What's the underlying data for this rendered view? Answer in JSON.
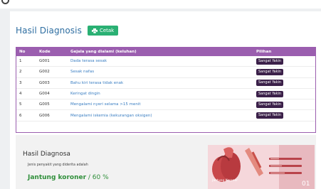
{
  "page": {
    "title": "Hasil Diagnosis",
    "print_button_label": "Cetak"
  },
  "table": {
    "headers": [
      "No",
      "Kode",
      "Gejala yang dialami (keluhan)",
      "Pilihan"
    ],
    "rows": [
      {
        "no": "1",
        "kode": "G001",
        "gejala": "Dada terasa sesak",
        "pilihan": "Sangat Yakin"
      },
      {
        "no": "2",
        "kode": "G002",
        "gejala": "Sesak nafas",
        "pilihan": "Sangat Yakin"
      },
      {
        "no": "3",
        "kode": "G003",
        "gejala": "Bahu kiri terasa tidak enak",
        "pilihan": "Sangat Yakin"
      },
      {
        "no": "4",
        "kode": "G004",
        "gejala": "Keringat dingin",
        "pilihan": "Sangat Yakin"
      },
      {
        "no": "5",
        "kode": "G005",
        "gejala": "Mengalami nyeri selama >15 menit",
        "pilihan": "Sangat Yakin"
      },
      {
        "no": "6",
        "kode": "G006",
        "gejala": "Mengalami iskemia (kekurangan oksigen)",
        "pilihan": "Sangat Yakin"
      }
    ]
  },
  "result": {
    "title": "Hasil Diagnosa",
    "description": "Jenis penyakit yang diderita adalah",
    "diagnosis": "Jantung koroner",
    "percentage": "/ 60 %"
  },
  "infographic": {
    "caption": "Jantung Koroner",
    "number": "01"
  },
  "colors": {
    "title": "#2e6ea1",
    "print_button": "#2ab073",
    "table_header": "#9b5eaf",
    "badge": "#3b2049",
    "diagnosis": "#2f8f3a",
    "symptom_link": "#3a7ec2"
  },
  "icons": {
    "print": "print-icon"
  }
}
